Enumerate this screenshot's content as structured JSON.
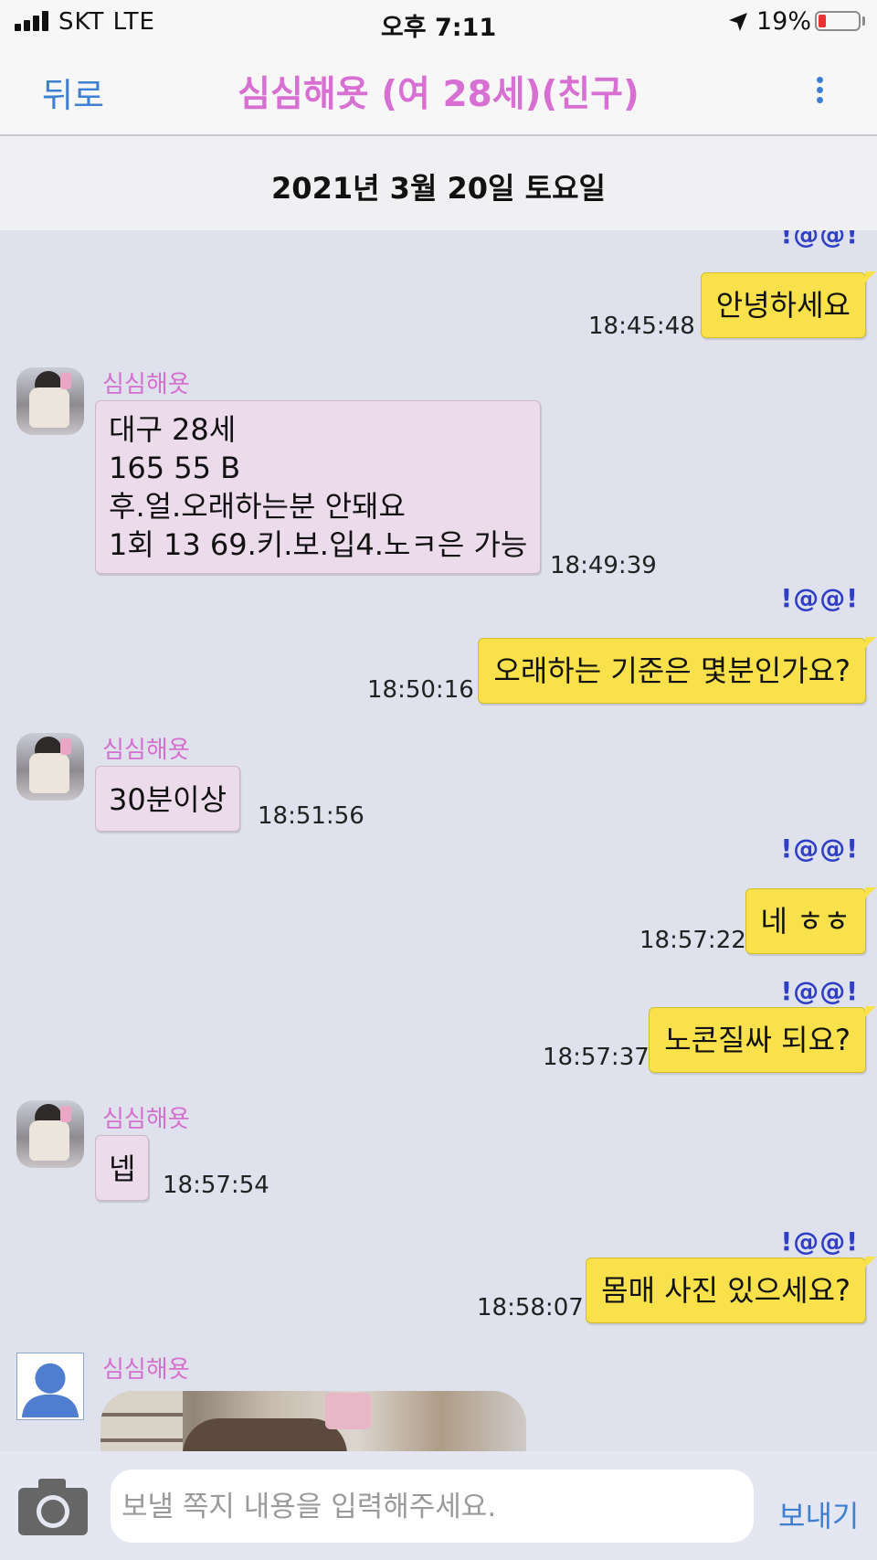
{
  "status_bar": {
    "carrier": "SKT   LTE",
    "time": "오후 7:11",
    "battery_percent": "19%",
    "battery_level": 0.19,
    "location_icon": "location-arrow-icon",
    "signal_icon": "signal-bars-icon"
  },
  "nav": {
    "back_label": "뒤로",
    "title": "심심해욧 (여 28세)(친구)",
    "more_icon": "more-vertical-icon"
  },
  "date_header": "2021년 3월 20일 토요일",
  "messages": [
    {
      "direction": "out",
      "tag": "!@@!",
      "text": "안녕하세요",
      "time": "18:45:48"
    },
    {
      "direction": "in",
      "sender": "심심해욧",
      "text": "대구 28세\n165 55 B\n후.얼.오래하는분 안돼요\n1회 13 69.키.보.입4.노ㅋ은 가능",
      "time": "18:49:39"
    },
    {
      "direction": "out",
      "tag": "!@@!",
      "text": "오래하는 기준은 몇분인가요?",
      "time": "18:50:16"
    },
    {
      "direction": "in",
      "sender": "심심해욧",
      "text": "30분이상",
      "time": "18:51:56"
    },
    {
      "direction": "out",
      "tag": "!@@!",
      "text": "네 ㅎㅎ",
      "time": "18:57:22"
    },
    {
      "direction": "out",
      "tag": "!@@!",
      "text": "노콘질싸 되요?",
      "time": "18:57:37"
    },
    {
      "direction": "in",
      "sender": "심심해욧",
      "text": "넵",
      "time": "18:57:54"
    },
    {
      "direction": "out",
      "tag": "!@@!",
      "text": "몸매 사진 있으세요?",
      "time": "18:58:07"
    },
    {
      "direction": "in",
      "sender": "심심해욧",
      "type": "photo"
    }
  ],
  "composer": {
    "placeholder": "보낼 쪽지 내용을 입력해주세요.",
    "value": "",
    "send_label": "보내기",
    "camera_icon": "camera-icon"
  },
  "colors": {
    "accent": "#3d7fd2",
    "title_pink": "#d86fd3",
    "sender_pink": "#d56fd0",
    "outgoing_bubble": "#f8e14a",
    "incoming_bubble": "#ecdbea",
    "tag_blue": "#2e3fc5",
    "chat_background": "#dfe1ec"
  }
}
